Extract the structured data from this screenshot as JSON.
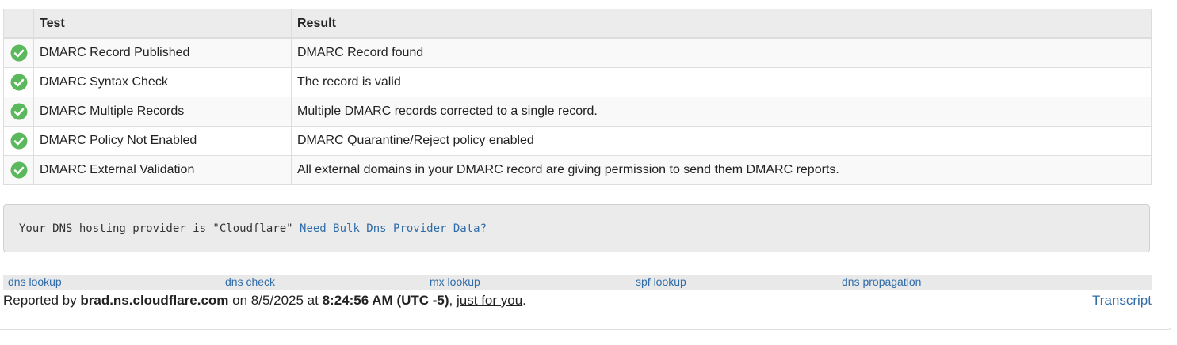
{
  "table": {
    "headers": [
      "Test",
      "Result"
    ],
    "status_icon": "check-circle-icon",
    "status_color": "#5cb85c",
    "rows": [
      {
        "test": "DMARC Record Published",
        "result": "DMARC Record found"
      },
      {
        "test": "DMARC Syntax Check",
        "result": "The record is valid"
      },
      {
        "test": "DMARC Multiple Records",
        "result": "Multiple DMARC records corrected to a single record."
      },
      {
        "test": "DMARC Policy Not Enabled",
        "result": "DMARC Quarantine/Reject policy enabled"
      },
      {
        "test": "DMARC External Validation",
        "result": "All external domains in your DMARC record are giving permission to send them DMARC reports."
      }
    ]
  },
  "dns_provider": {
    "text": "Your DNS hosting provider is \"Cloudflare\"",
    "link": "Need Bulk Dns Provider Data?"
  },
  "links": [
    "dns lookup",
    "dns check",
    "mx lookup",
    "spf lookup",
    "dns propagation"
  ],
  "footer": {
    "reported_by": "Reported by",
    "server": "brad.ns.cloudflare.com",
    "on": "on 8/5/2025 at",
    "time": "8:24:56 AM (UTC -5)",
    "comma": ",",
    "just_for_you": "just for you",
    "period": ".",
    "transcript": "Transcript"
  },
  "colors": {
    "link": "#2f6ca8",
    "header_bg": "#ececec",
    "box_bg": "#ebebeb"
  }
}
